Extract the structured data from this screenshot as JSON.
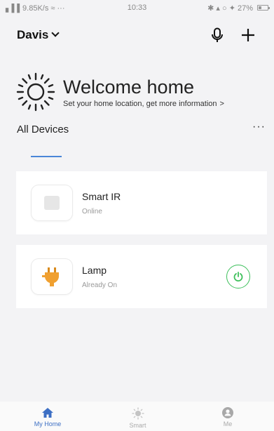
{
  "status_bar": {
    "left": "▖▌▌9.85K/s ≈ ···",
    "time": "10:33",
    "right": "✱ ▴ ○ ✦ 27%"
  },
  "header": {
    "home_name": "Davis"
  },
  "welcome": {
    "title": "Welcome home",
    "subtitle": "Set your home location, get more information",
    "arrow": ">"
  },
  "section": {
    "title": "All Devices",
    "more": "···"
  },
  "devices": [
    {
      "name": "Smart IR",
      "status": "Online"
    },
    {
      "name": "Lamp",
      "status": "Already On"
    }
  ],
  "nav": [
    {
      "label": "My Home"
    },
    {
      "label": "Smart"
    },
    {
      "label": "Me"
    }
  ],
  "colors": {
    "accent": "#3d6fc4",
    "power_green": "#3cbf5a",
    "plug_orange": "#f0a030"
  }
}
